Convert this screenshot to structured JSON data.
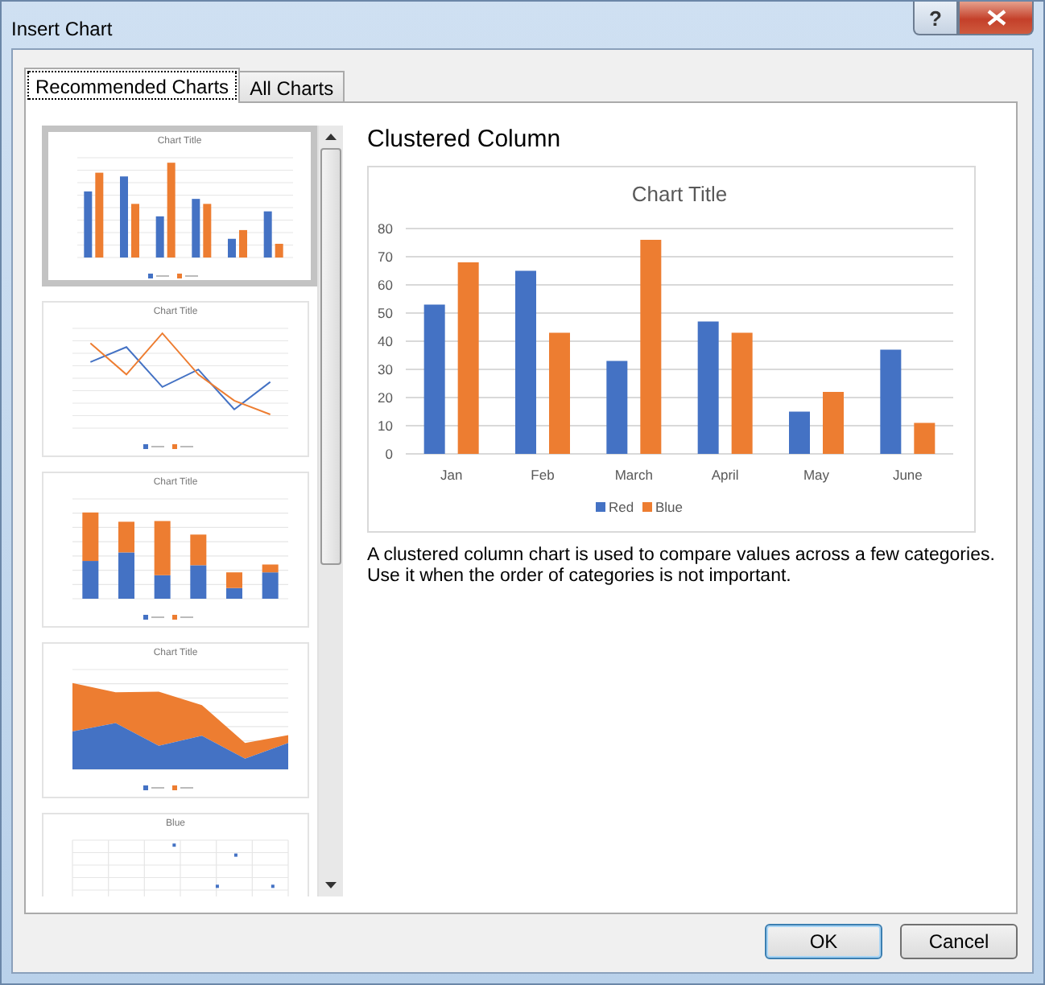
{
  "window": {
    "title": "Insert Chart",
    "help": "?"
  },
  "tabs": [
    {
      "label": "Recommended Charts",
      "selected": true
    },
    {
      "label": "All Charts",
      "selected": false
    }
  ],
  "thumbnails": [
    {
      "kind": "column",
      "title": "Chart Title",
      "selected": true
    },
    {
      "kind": "line",
      "title": "Chart Title",
      "selected": false
    },
    {
      "kind": "stacked",
      "title": "Chart Title",
      "selected": false
    },
    {
      "kind": "area",
      "title": "Chart Title",
      "selected": false
    },
    {
      "kind": "scatter",
      "title": "Blue",
      "selected": false
    }
  ],
  "preview": {
    "heading": "Clustered Column",
    "chart_data": {
      "type": "bar",
      "title": "Chart Title",
      "categories": [
        "Jan",
        "Feb",
        "March",
        "April",
        "May",
        "June"
      ],
      "series": [
        {
          "name": "Red",
          "color": "#4472c4",
          "values": [
            53,
            65,
            33,
            47,
            15,
            37
          ]
        },
        {
          "name": "Blue",
          "color": "#ed7d31",
          "values": [
            68,
            43,
            76,
            43,
            22,
            11
          ]
        }
      ],
      "ylim": [
        0,
        80
      ],
      "yticks": [
        0,
        10,
        20,
        30,
        40,
        50,
        60,
        70,
        80
      ],
      "grid": true,
      "legend": "bottom"
    },
    "description": "A clustered column chart is used to compare values across a few categories. Use it when the order of categories is not important."
  },
  "buttons": [
    {
      "label": "OK",
      "default": true
    },
    {
      "label": "Cancel",
      "default": false
    }
  ]
}
